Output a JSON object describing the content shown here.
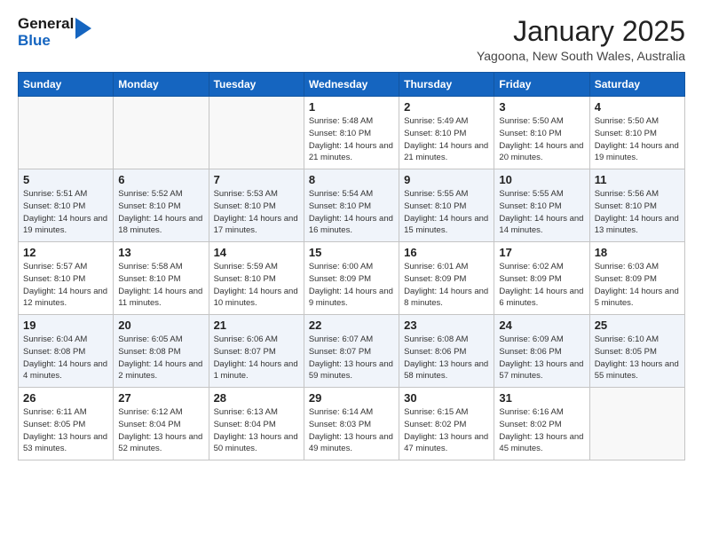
{
  "header": {
    "logo_line1": "General",
    "logo_line2": "Blue",
    "month": "January 2025",
    "location": "Yagoona, New South Wales, Australia"
  },
  "weekdays": [
    "Sunday",
    "Monday",
    "Tuesday",
    "Wednesday",
    "Thursday",
    "Friday",
    "Saturday"
  ],
  "weeks": [
    [
      {
        "day": "",
        "info": ""
      },
      {
        "day": "",
        "info": ""
      },
      {
        "day": "",
        "info": ""
      },
      {
        "day": "1",
        "info": "Sunrise: 5:48 AM\nSunset: 8:10 PM\nDaylight: 14 hours\nand 21 minutes."
      },
      {
        "day": "2",
        "info": "Sunrise: 5:49 AM\nSunset: 8:10 PM\nDaylight: 14 hours\nand 21 minutes."
      },
      {
        "day": "3",
        "info": "Sunrise: 5:50 AM\nSunset: 8:10 PM\nDaylight: 14 hours\nand 20 minutes."
      },
      {
        "day": "4",
        "info": "Sunrise: 5:50 AM\nSunset: 8:10 PM\nDaylight: 14 hours\nand 19 minutes."
      }
    ],
    [
      {
        "day": "5",
        "info": "Sunrise: 5:51 AM\nSunset: 8:10 PM\nDaylight: 14 hours\nand 19 minutes."
      },
      {
        "day": "6",
        "info": "Sunrise: 5:52 AM\nSunset: 8:10 PM\nDaylight: 14 hours\nand 18 minutes."
      },
      {
        "day": "7",
        "info": "Sunrise: 5:53 AM\nSunset: 8:10 PM\nDaylight: 14 hours\nand 17 minutes."
      },
      {
        "day": "8",
        "info": "Sunrise: 5:54 AM\nSunset: 8:10 PM\nDaylight: 14 hours\nand 16 minutes."
      },
      {
        "day": "9",
        "info": "Sunrise: 5:55 AM\nSunset: 8:10 PM\nDaylight: 14 hours\nand 15 minutes."
      },
      {
        "day": "10",
        "info": "Sunrise: 5:55 AM\nSunset: 8:10 PM\nDaylight: 14 hours\nand 14 minutes."
      },
      {
        "day": "11",
        "info": "Sunrise: 5:56 AM\nSunset: 8:10 PM\nDaylight: 14 hours\nand 13 minutes."
      }
    ],
    [
      {
        "day": "12",
        "info": "Sunrise: 5:57 AM\nSunset: 8:10 PM\nDaylight: 14 hours\nand 12 minutes."
      },
      {
        "day": "13",
        "info": "Sunrise: 5:58 AM\nSunset: 8:10 PM\nDaylight: 14 hours\nand 11 minutes."
      },
      {
        "day": "14",
        "info": "Sunrise: 5:59 AM\nSunset: 8:10 PM\nDaylight: 14 hours\nand 10 minutes."
      },
      {
        "day": "15",
        "info": "Sunrise: 6:00 AM\nSunset: 8:09 PM\nDaylight: 14 hours\nand 9 minutes."
      },
      {
        "day": "16",
        "info": "Sunrise: 6:01 AM\nSunset: 8:09 PM\nDaylight: 14 hours\nand 8 minutes."
      },
      {
        "day": "17",
        "info": "Sunrise: 6:02 AM\nSunset: 8:09 PM\nDaylight: 14 hours\nand 6 minutes."
      },
      {
        "day": "18",
        "info": "Sunrise: 6:03 AM\nSunset: 8:09 PM\nDaylight: 14 hours\nand 5 minutes."
      }
    ],
    [
      {
        "day": "19",
        "info": "Sunrise: 6:04 AM\nSunset: 8:08 PM\nDaylight: 14 hours\nand 4 minutes."
      },
      {
        "day": "20",
        "info": "Sunrise: 6:05 AM\nSunset: 8:08 PM\nDaylight: 14 hours\nand 2 minutes."
      },
      {
        "day": "21",
        "info": "Sunrise: 6:06 AM\nSunset: 8:07 PM\nDaylight: 14 hours\nand 1 minute."
      },
      {
        "day": "22",
        "info": "Sunrise: 6:07 AM\nSunset: 8:07 PM\nDaylight: 13 hours\nand 59 minutes."
      },
      {
        "day": "23",
        "info": "Sunrise: 6:08 AM\nSunset: 8:06 PM\nDaylight: 13 hours\nand 58 minutes."
      },
      {
        "day": "24",
        "info": "Sunrise: 6:09 AM\nSunset: 8:06 PM\nDaylight: 13 hours\nand 57 minutes."
      },
      {
        "day": "25",
        "info": "Sunrise: 6:10 AM\nSunset: 8:05 PM\nDaylight: 13 hours\nand 55 minutes."
      }
    ],
    [
      {
        "day": "26",
        "info": "Sunrise: 6:11 AM\nSunset: 8:05 PM\nDaylight: 13 hours\nand 53 minutes."
      },
      {
        "day": "27",
        "info": "Sunrise: 6:12 AM\nSunset: 8:04 PM\nDaylight: 13 hours\nand 52 minutes."
      },
      {
        "day": "28",
        "info": "Sunrise: 6:13 AM\nSunset: 8:04 PM\nDaylight: 13 hours\nand 50 minutes."
      },
      {
        "day": "29",
        "info": "Sunrise: 6:14 AM\nSunset: 8:03 PM\nDaylight: 13 hours\nand 49 minutes."
      },
      {
        "day": "30",
        "info": "Sunrise: 6:15 AM\nSunset: 8:02 PM\nDaylight: 13 hours\nand 47 minutes."
      },
      {
        "day": "31",
        "info": "Sunrise: 6:16 AM\nSunset: 8:02 PM\nDaylight: 13 hours\nand 45 minutes."
      },
      {
        "day": "",
        "info": ""
      }
    ]
  ]
}
